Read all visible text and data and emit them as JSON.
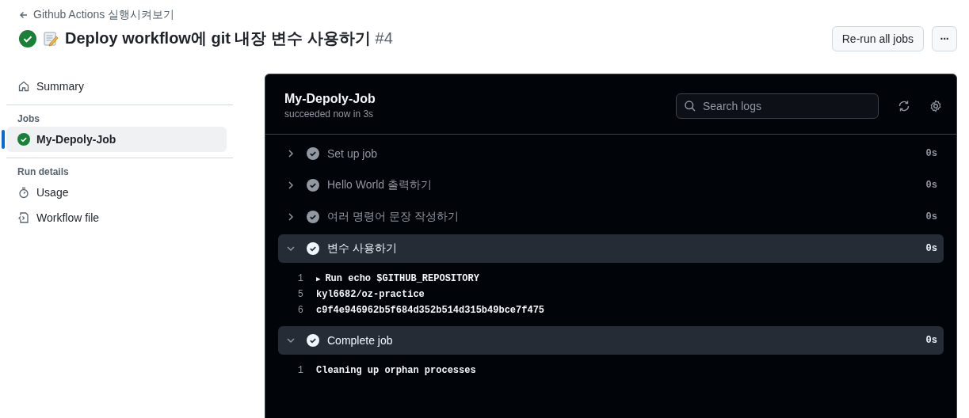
{
  "breadcrumb": {
    "label": "Github Actions 실행시켜보기"
  },
  "run": {
    "title": "Deploy workflow에 git 내장 변수 사용하기",
    "number": "#4",
    "succeeded": true
  },
  "buttons": [
    "Re-run all jobs"
  ],
  "more_button": {
    "label": "···"
  },
  "sidebar": {
    "summary": "Summary",
    "jobs_heading": "Jobs",
    "jobs": [
      {
        "name": "My-Depoly-Job",
        "succeeded": true,
        "selected": true
      }
    ],
    "details_heading": "Run details",
    "details": [
      {
        "kind": "usage",
        "label": "Usage"
      },
      {
        "kind": "file",
        "label": "Workflow file"
      }
    ]
  },
  "job": {
    "name": "My-Depoly-Job",
    "subtitle": "succeeded now in 3s",
    "search": {
      "placeholder": "Search logs"
    },
    "steps": [
      {
        "name": "Set up job",
        "duration": "0s",
        "expanded": false
      },
      {
        "name": "Hello World 출력하기",
        "duration": "0s",
        "expanded": false
      },
      {
        "name": "여러 명령어 문장 작성하기",
        "duration": "0s",
        "expanded": false
      },
      {
        "name": "변수 사용하기",
        "duration": "0s",
        "expanded": true,
        "lines": [
          {
            "number": "1",
            "marker": "▶",
            "text": "Run echo $GITHUB_REPOSITORY"
          },
          {
            "number": "5",
            "text": "kyl6682/oz-practice"
          },
          {
            "number": "6",
            "text": "c9f4e946962b5f684d352b514d315b49bce7f475"
          }
        ]
      },
      {
        "name": "Complete job",
        "duration": "0s",
        "expanded": true,
        "lines": [
          {
            "number": "1",
            "text": "Cleaning up orphan processes"
          }
        ]
      }
    ]
  }
}
